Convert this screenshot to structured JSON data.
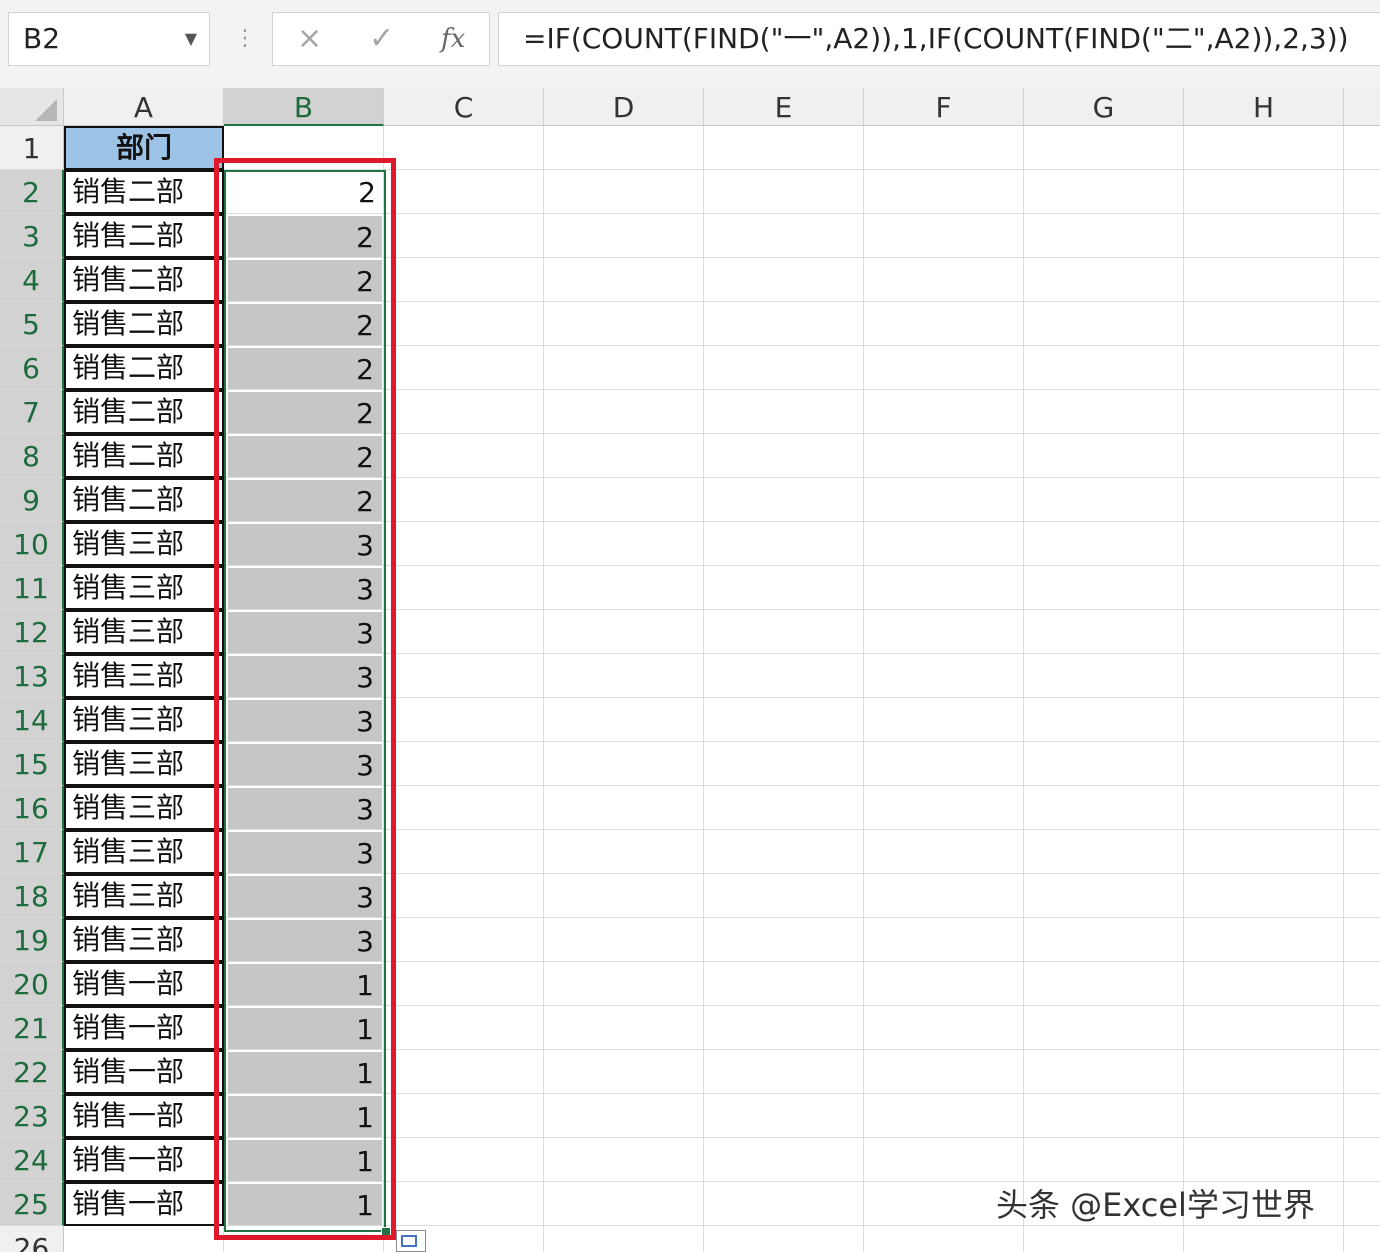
{
  "name_box": "B2",
  "formula_bar": {
    "cancel_icon": "×",
    "enter_icon": "✓",
    "fx_label": "fx",
    "formula": "=IF(COUNT(FIND(\"一\",A2)),1,IF(COUNT(FIND(\"二\",A2)),2,3))"
  },
  "columns": [
    "A",
    "B",
    "C",
    "D",
    "E",
    "F",
    "G",
    "H"
  ],
  "rows": [
    "1",
    "2",
    "3",
    "4",
    "5",
    "6",
    "7",
    "8",
    "9",
    "10",
    "11",
    "12",
    "13",
    "14",
    "15",
    "16",
    "17",
    "18",
    "19",
    "20",
    "21",
    "22",
    "23",
    "24",
    "25",
    "26"
  ],
  "header_cell": "部门",
  "department_cells": [
    "销售二部",
    "销售二部",
    "销售二部",
    "销售二部",
    "销售二部",
    "销售二部",
    "销售二部",
    "销售二部",
    "销售三部",
    "销售三部",
    "销售三部",
    "销售三部",
    "销售三部",
    "销售三部",
    "销售三部",
    "销售三部",
    "销售三部",
    "销售三部",
    "销售一部",
    "销售一部",
    "销售一部",
    "销售一部",
    "销售一部",
    "销售一部"
  ],
  "result_cells": [
    "2",
    "2",
    "2",
    "2",
    "2",
    "2",
    "2",
    "2",
    "3",
    "3",
    "3",
    "3",
    "3",
    "3",
    "3",
    "3",
    "3",
    "3",
    "1",
    "1",
    "1",
    "1",
    "1",
    "1"
  ],
  "watermark": "头条 @Excel学习世界",
  "colors": {
    "header_fill": "#9dc3e6",
    "selection_shade": "#c6c6c6",
    "selection_border": "#217346",
    "highlight_box": "#e0182b"
  }
}
